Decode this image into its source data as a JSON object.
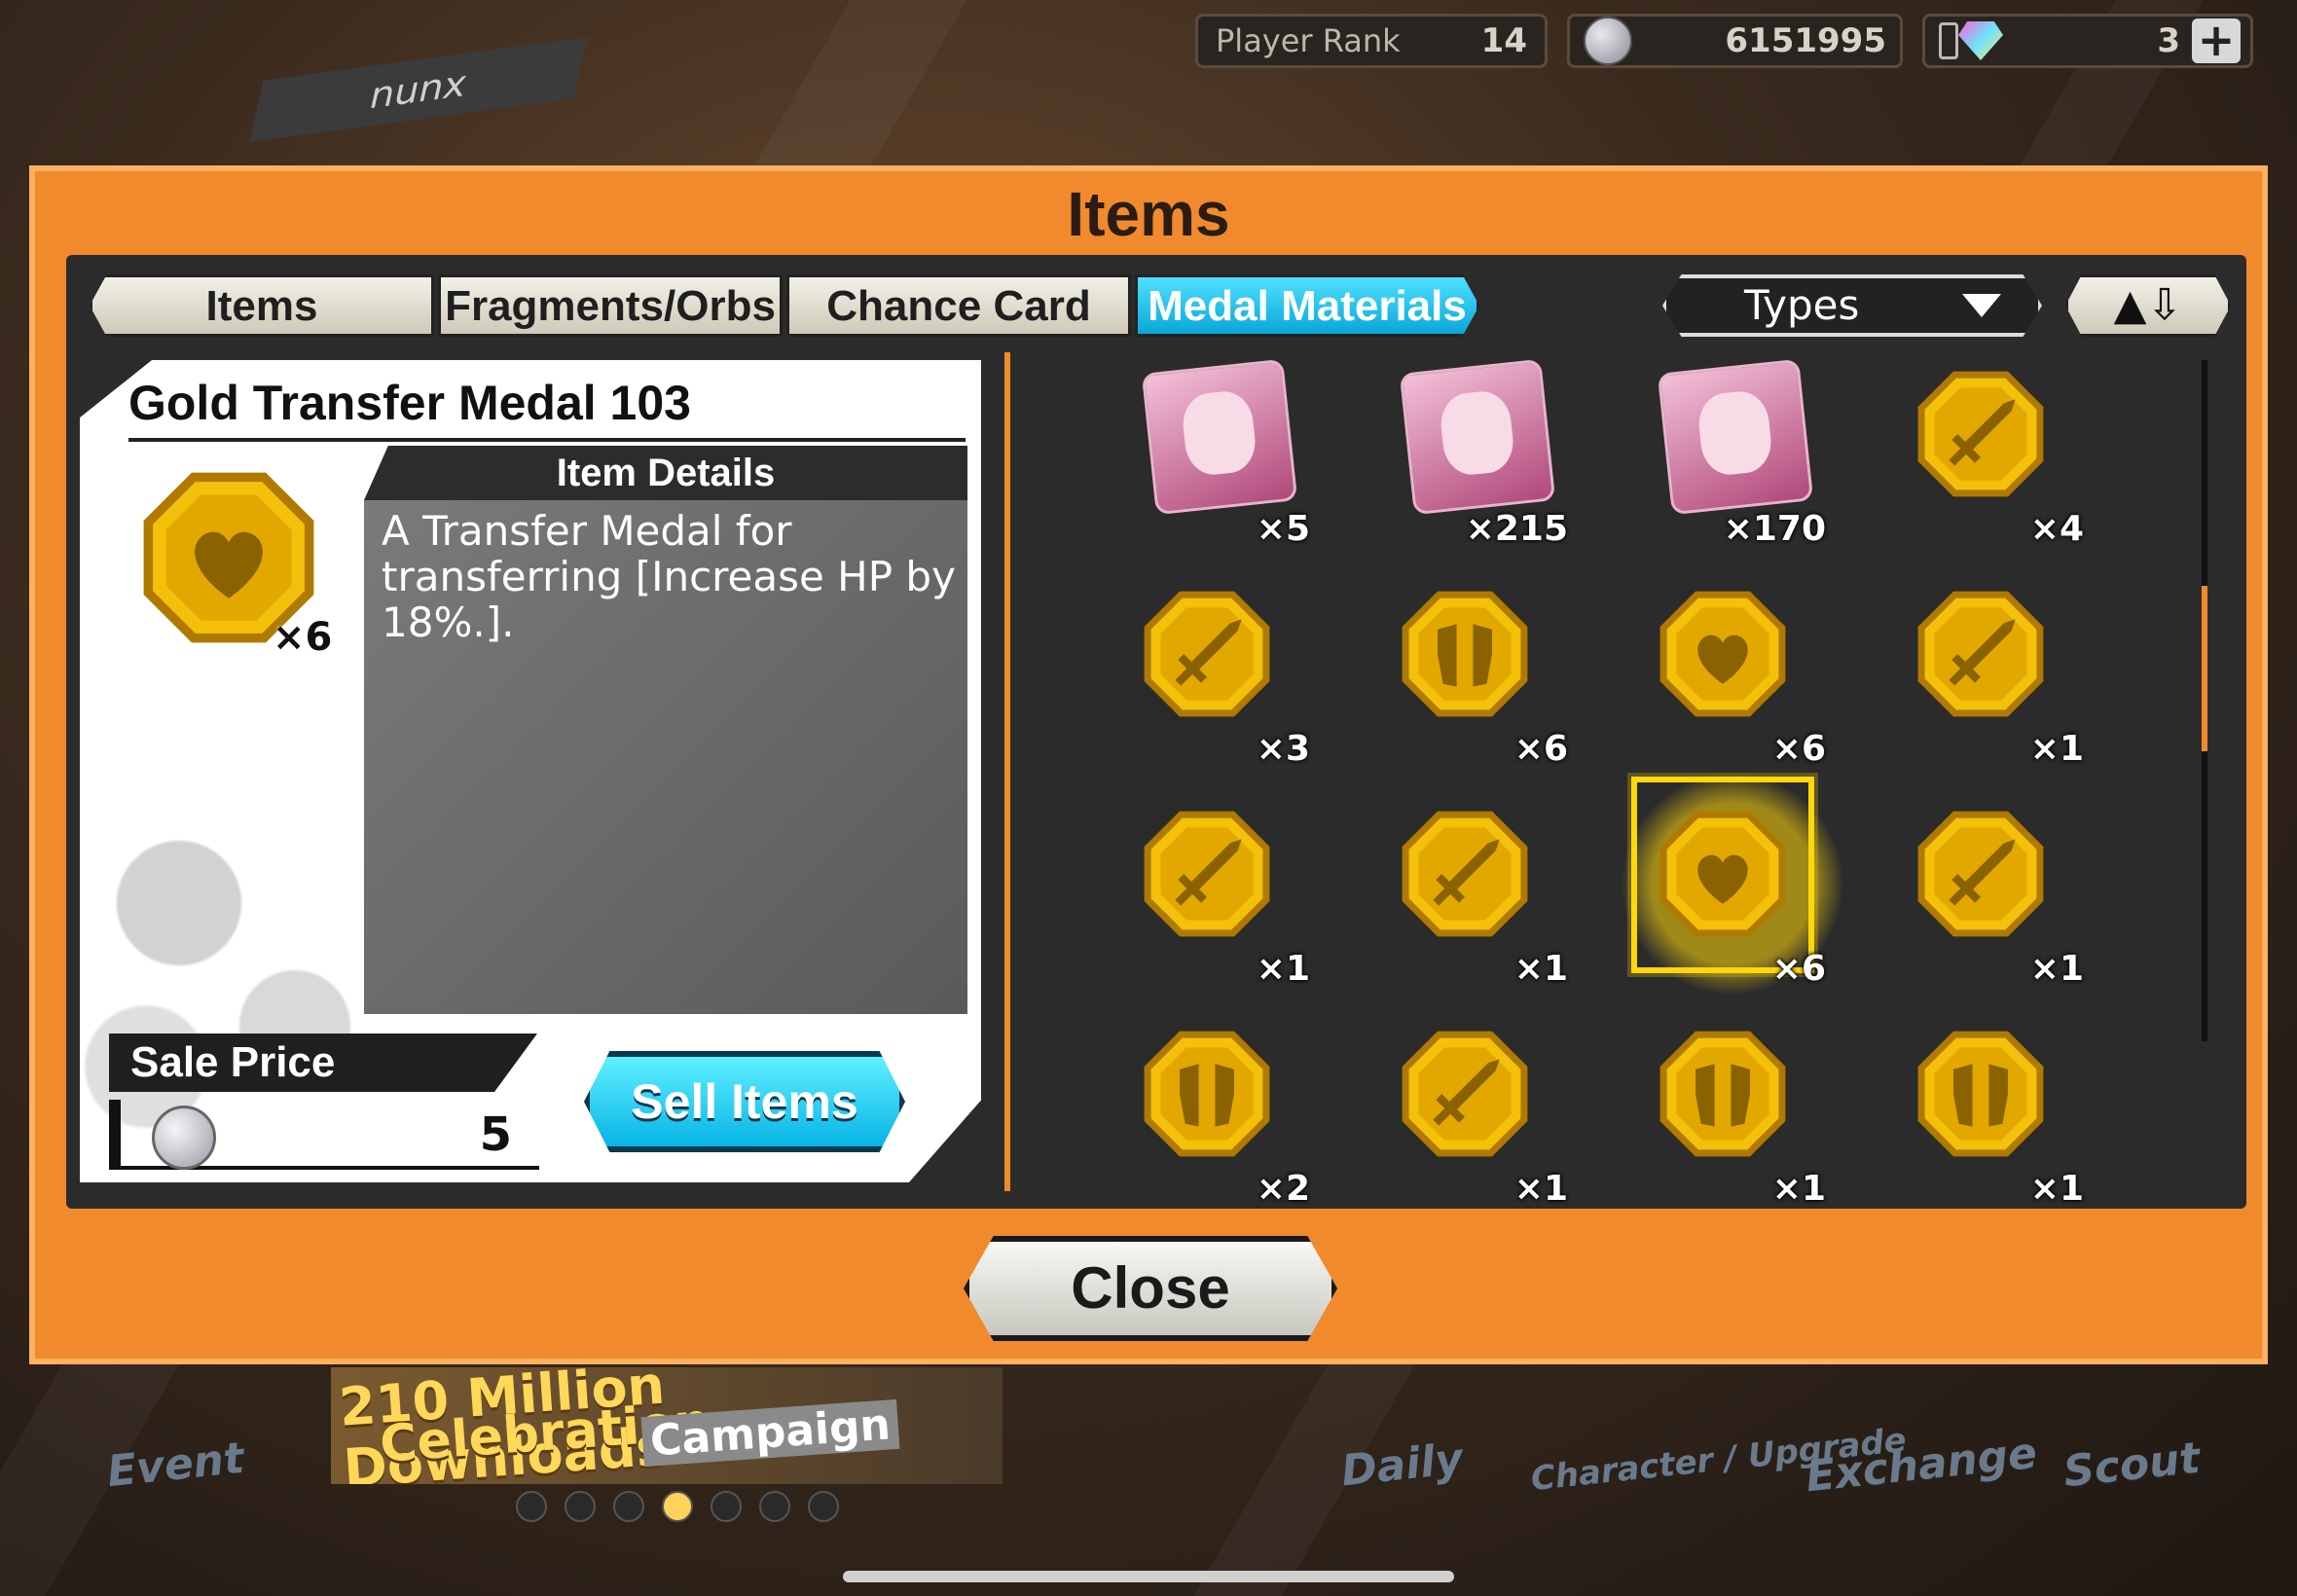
{
  "hud": {
    "rank_label": "Player Rank",
    "rank_value": "14",
    "berries": "6151995",
    "gems": "3",
    "plus": "+"
  },
  "user": {
    "name": "nunx"
  },
  "modal": {
    "title": "Items"
  },
  "tabs": [
    {
      "label": "Items",
      "active": false
    },
    {
      "label": "Fragments/Orbs",
      "active": false
    },
    {
      "label": "Chance Card",
      "active": false
    },
    {
      "label": "Medal Materials",
      "active": true
    }
  ],
  "filter": {
    "types_label": "Types",
    "sort_icon": "sort-up-down-icon"
  },
  "selected_item": {
    "name": "Gold Transfer Medal 103",
    "qty": "×6",
    "details_header": "Item Details",
    "description": "A Transfer Medal for transferring [Increase HP by 18%.].",
    "sale_price_label": "Sale Price",
    "sale_price": "5",
    "sell_button": "Sell Items"
  },
  "grid": [
    {
      "icon": "portrait-girl-icon",
      "qty": "×5"
    },
    {
      "icon": "portrait-big-mom-icon",
      "qty": "×215"
    },
    {
      "icon": "portrait-old-man-icon",
      "qty": "×170"
    },
    {
      "icon": "sword-medal-icon",
      "qty": "×4"
    },
    {
      "icon": "sword-medal-icon",
      "qty": "×3"
    },
    {
      "icon": "armor-medal-icon",
      "qty": "×6"
    },
    {
      "icon": "heart-medal-icon",
      "qty": "×6"
    },
    {
      "icon": "sword-medal-icon",
      "qty": "×1"
    },
    {
      "icon": "sword-medal-icon",
      "qty": "×1"
    },
    {
      "icon": "sword-medal-icon",
      "qty": "×1"
    },
    {
      "icon": "heart-medal-icon",
      "qty": "×6",
      "selected": true
    },
    {
      "icon": "sword-medal-icon",
      "qty": "×1"
    },
    {
      "icon": "armor-medal-icon",
      "qty": "×2"
    },
    {
      "icon": "sword-medal-icon",
      "qty": "×1"
    },
    {
      "icon": "armor-medal-icon",
      "qty": "×1"
    },
    {
      "icon": "armor-medal-icon",
      "qty": "×1"
    }
  ],
  "close_button": "Close",
  "banner": {
    "line1": "210 Million Downloads",
    "line2": "Celebration",
    "line3": "Campaign"
  },
  "bottom_nav": [
    "Event",
    "Daily",
    "Character / Upgrade",
    "Exchange",
    "Scout"
  ],
  "carousel": {
    "count": 7,
    "active": 3
  },
  "colors": {
    "accent": "#f08a2c",
    "active_tab": "#0aa7d8",
    "medal_gold": "#f4b800"
  }
}
